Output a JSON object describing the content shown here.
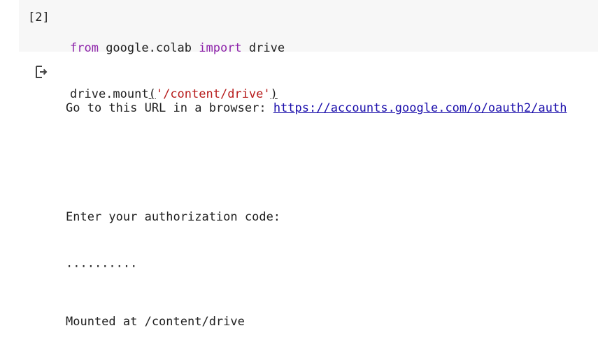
{
  "cell": {
    "execution_count": "[2]",
    "code": {
      "line1": {
        "kw_from": "from",
        "module": " google.colab ",
        "kw_import": "import",
        "name": " drive"
      },
      "line2": {
        "call": "drive.mount",
        "open_paren": "(",
        "arg": "'/content/drive'",
        "close_paren": ")"
      }
    }
  },
  "output": {
    "icon": "output-redirect-icon",
    "url_prompt": "Go to this URL in a browser: ",
    "url_text": "https://accounts.google.com/o/oauth2/auth",
    "auth_prompt": "Enter your authorization code:",
    "auth_code_masked": "··········",
    "mounted_message": "Mounted at /content/drive"
  }
}
